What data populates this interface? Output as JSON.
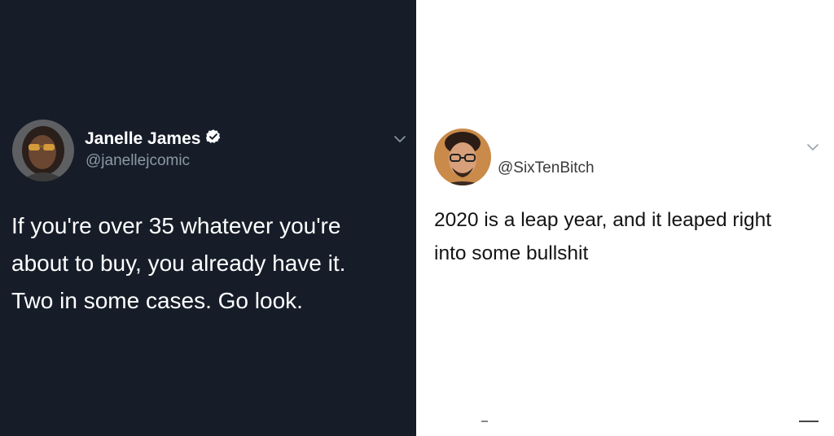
{
  "left_tweet": {
    "display_name": "Janelle James",
    "verified_icon": "verified-badge-icon",
    "handle": "@janellejcomic",
    "menu_icon": "chevron-down-icon",
    "text_lines": [
      "If you're over 35 whatever you're",
      "about to buy, you already have it.",
      "Two in some cases. Go look."
    ],
    "theme": {
      "background": "#161d29",
      "text": "#ffffff",
      "muted": "#8b98a5"
    }
  },
  "right_tweet": {
    "handle": "@SixTenBitch",
    "menu_icon": "chevron-down-icon",
    "text_lines": [
      "2020 is a leap year, and it leaped right",
      "into some bullshit"
    ],
    "theme": {
      "background": "#ffffff",
      "text": "#141414",
      "muted": "#3a3a3a"
    }
  }
}
